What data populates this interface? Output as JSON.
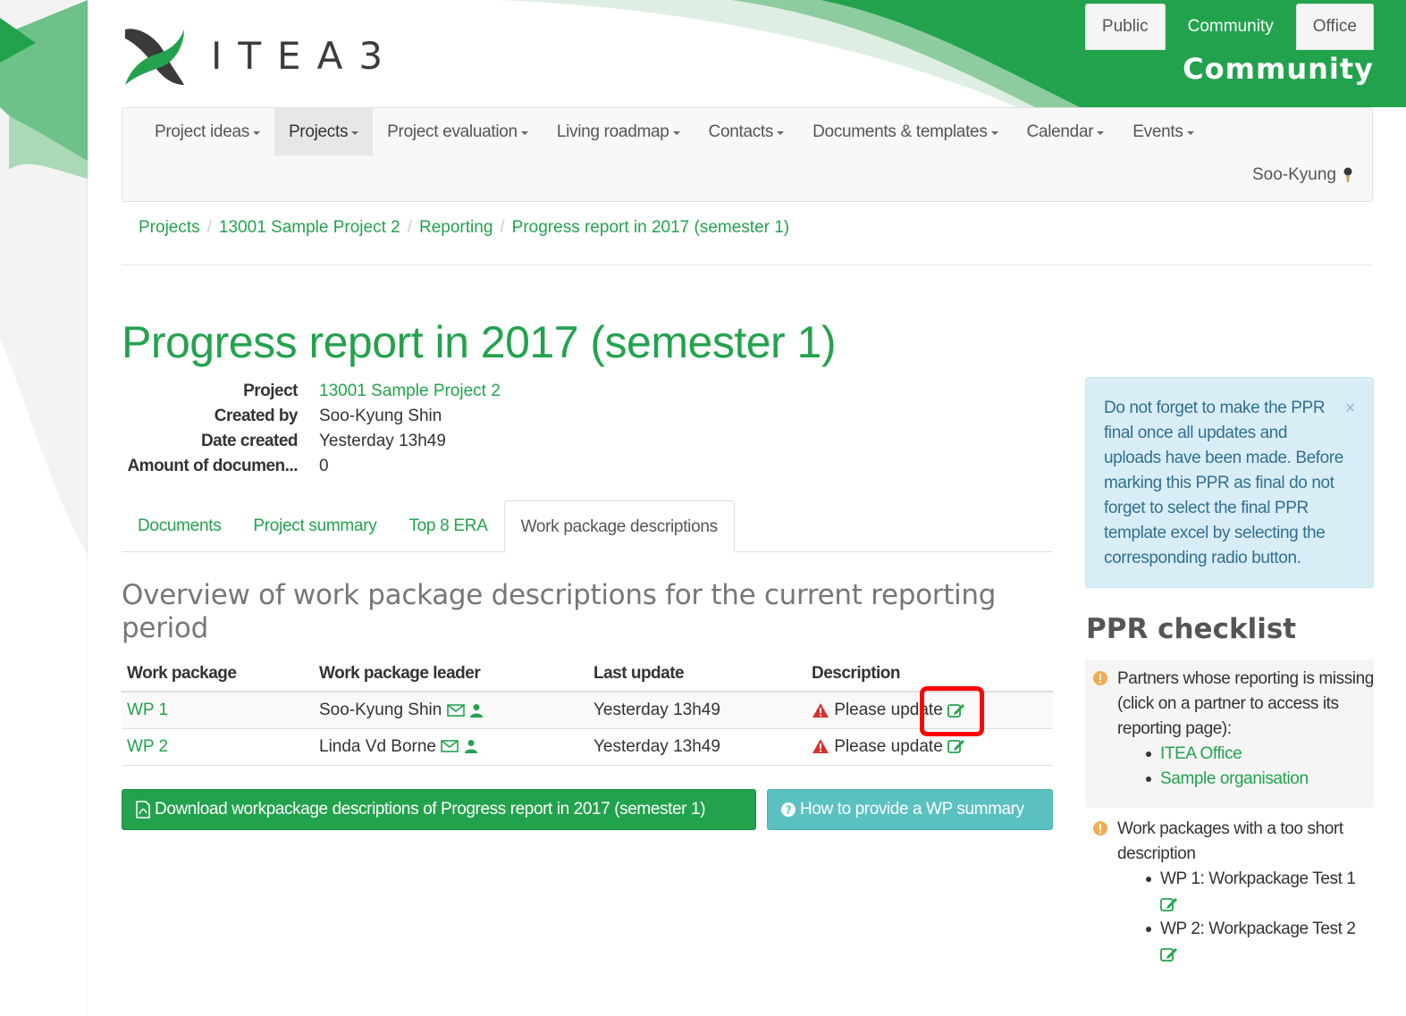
{
  "brand": {
    "logo_text": "ITEA",
    "logo_suffix": "3",
    "primary_color": "#23a24d"
  },
  "top_tabs": [
    {
      "label": "Public",
      "active": false
    },
    {
      "label": "Community",
      "active": true
    },
    {
      "label": "Office",
      "active": false
    }
  ],
  "header": {
    "section_label": "Community"
  },
  "nav": {
    "items": [
      {
        "label": "Project ideas"
      },
      {
        "label": "Projects"
      },
      {
        "label": "Project evaluation"
      },
      {
        "label": "Living roadmap"
      },
      {
        "label": "Contacts"
      },
      {
        "label": "Documents & templates"
      },
      {
        "label": "Calendar"
      },
      {
        "label": "Events"
      }
    ],
    "user_name": "Soo-Kyung"
  },
  "breadcrumb": [
    {
      "label": "Projects"
    },
    {
      "label": "13001 Sample Project 2"
    },
    {
      "label": "Reporting"
    },
    {
      "label": "Progress report in 2017 (semester 1)"
    }
  ],
  "page": {
    "title": "Progress report in 2017 (semester 1)"
  },
  "meta": {
    "project_label": "Project",
    "project_value": "13001 Sample Project 2",
    "created_by_label": "Created by",
    "created_by_value": "Soo-Kyung Shin",
    "date_created_label": "Date created",
    "date_created_value": "Yesterday 13h49",
    "amount_label": "Amount of documen...",
    "amount_value": "0"
  },
  "tabs": [
    {
      "label": "Documents"
    },
    {
      "label": "Project summary"
    },
    {
      "label": "Top 8 ERA"
    },
    {
      "label": "Work package descriptions"
    }
  ],
  "section": {
    "heading": "Overview of work package descriptions for the current reporting period"
  },
  "wp_table": {
    "headers": {
      "work_package": "Work package",
      "leader": "Work package leader",
      "last_update": "Last update",
      "description": "Description"
    },
    "rows": [
      {
        "wp": "WP 1",
        "leader": "Soo-Kyung Shin",
        "last_update": "Yesterday 13h49",
        "description": "Please update"
      },
      {
        "wp": "WP 2",
        "leader": "Linda Vd Borne",
        "last_update": "Yesterday 13h49",
        "description": "Please update"
      }
    ]
  },
  "buttons": {
    "download": "Download workpackage descriptions of Progress report in 2017 (semester 1)",
    "how_to": "How to provide a WP summary"
  },
  "alert": {
    "text": "Do not forget to make the PPR final once all updates and uploads have been made. Before marking this PPR as final do not forget to select the final PPR template excel by selecting the corresponding radio button.",
    "close": "×"
  },
  "checklist": {
    "title": "PPR checklist",
    "items": [
      {
        "text": "Partners whose reporting is missing (click on a partner to access its reporting page):",
        "subitems": [
          "ITEA Office",
          "Sample organisation"
        ]
      },
      {
        "text": "Work packages with a too short description",
        "subitems": [
          "WP 1: Workpackage Test 1",
          "WP 2: Workpackage Test 2"
        ]
      }
    ]
  }
}
